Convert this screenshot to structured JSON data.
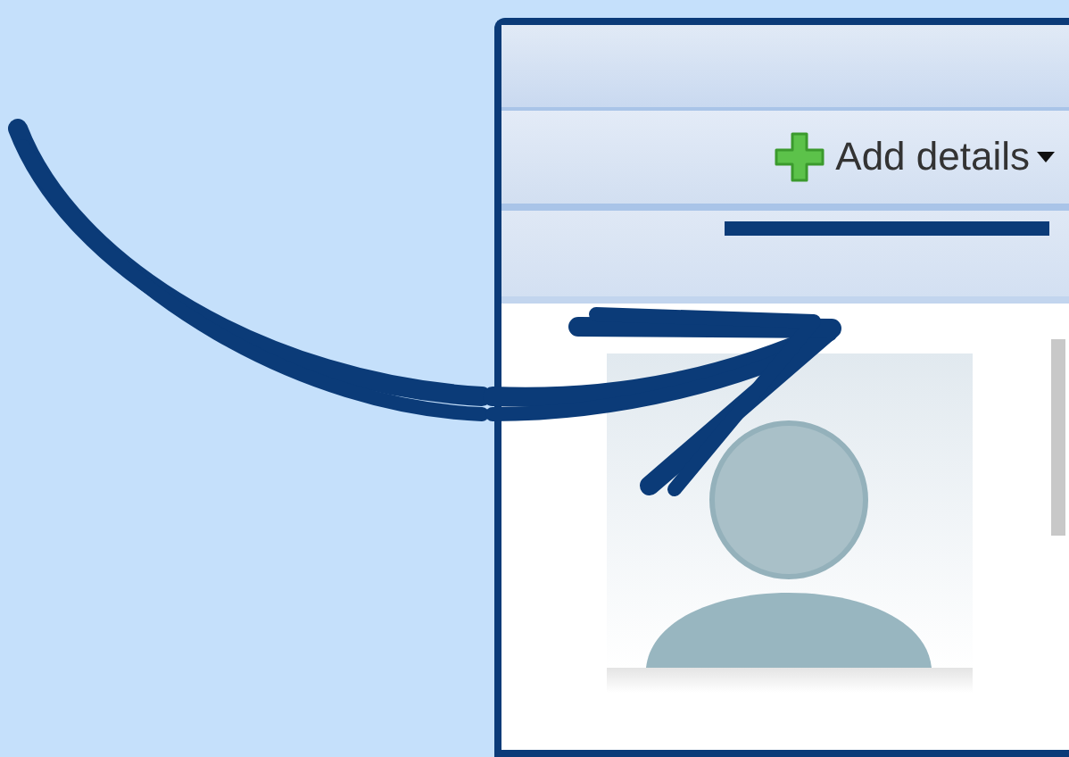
{
  "toolbar": {
    "add_button": {
      "label": "Add details"
    }
  }
}
